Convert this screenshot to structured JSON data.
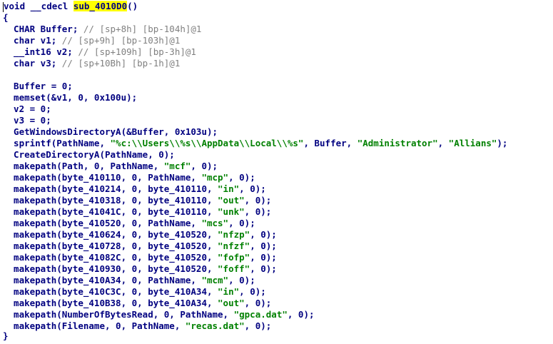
{
  "code": {
    "l1": {
      "a": "void __cdecl ",
      "fname": "sub_4010D0",
      "b": "()"
    },
    "l2": "{",
    "decl1": {
      "code": "  CHAR Buffer; ",
      "cmt": "// [sp+8h] [bp-104h]@1"
    },
    "decl2": {
      "code": "  char v1; ",
      "cmt": "// [sp+9h] [bp-103h]@1"
    },
    "decl3": {
      "code": "  __int16 v2; ",
      "cmt": "// [sp+109h] [bp-3h]@1"
    },
    "decl4": {
      "code": "  char v3; ",
      "cmt": "// [sp+10Bh] [bp-1h]@1"
    },
    "s1": "  Buffer = 0;",
    "s2": "  memset(&v1, 0, 0x100u);",
    "s3": "  v2 = 0;",
    "s4": "  v3 = 0;",
    "s5": "  GetWindowsDirectoryA(&Buffer, 0x103u);",
    "s6": {
      "a": "  sprintf(PathName, ",
      "s1": "\"%c:\\\\Users\\\\%s\\\\AppData\\\\Local\\\\%s\"",
      "b": ", Buffer, ",
      "s2": "\"Administrator\"",
      "c": ", ",
      "s3": "\"Allians\"",
      "d": ");"
    },
    "s7": "  CreateDirectoryA(PathName, 0);",
    "mp": [
      {
        "a": "  makepath(Path, 0, PathName, ",
        "s": "\"mcf\"",
        "b": ", 0);"
      },
      {
        "a": "  makepath(byte_410110, 0, PathName, ",
        "s": "\"mcp\"",
        "b": ", 0);"
      },
      {
        "a": "  makepath(byte_410214, 0, byte_410110, ",
        "s": "\"in\"",
        "b": ", 0);"
      },
      {
        "a": "  makepath(byte_410318, 0, byte_410110, ",
        "s": "\"out\"",
        "b": ", 0);"
      },
      {
        "a": "  makepath(byte_41041C, 0, byte_410110, ",
        "s": "\"unk\"",
        "b": ", 0);"
      },
      {
        "a": "  makepath(byte_410520, 0, PathName, ",
        "s": "\"mcs\"",
        "b": ", 0);"
      },
      {
        "a": "  makepath(byte_410624, 0, byte_410520, ",
        "s": "\"nfzp\"",
        "b": ", 0);"
      },
      {
        "a": "  makepath(byte_410728, 0, byte_410520, ",
        "s": "\"nfzf\"",
        "b": ", 0);"
      },
      {
        "a": "  makepath(byte_41082C, 0, byte_410520, ",
        "s": "\"fofp\"",
        "b": ", 0);"
      },
      {
        "a": "  makepath(byte_410930, 0, byte_410520, ",
        "s": "\"foff\"",
        "b": ", 0);"
      },
      {
        "a": "  makepath(byte_410A34, 0, PathName, ",
        "s": "\"mcm\"",
        "b": ", 0);"
      },
      {
        "a": "  makepath(byte_410C3C, 0, byte_410A34, ",
        "s": "\"in\"",
        "b": ", 0);"
      },
      {
        "a": "  makepath(byte_410B38, 0, byte_410A34, ",
        "s": "\"out\"",
        "b": ", 0);"
      },
      {
        "a": "  makepath(NumberOfBytesRead, 0, PathName, ",
        "s": "\"gpca.dat\"",
        "b": ", 0);"
      },
      {
        "a": "  makepath(Filename, 0, PathName, ",
        "s": "\"recas.dat\"",
        "b": ", 0);"
      }
    ],
    "last": "}"
  }
}
